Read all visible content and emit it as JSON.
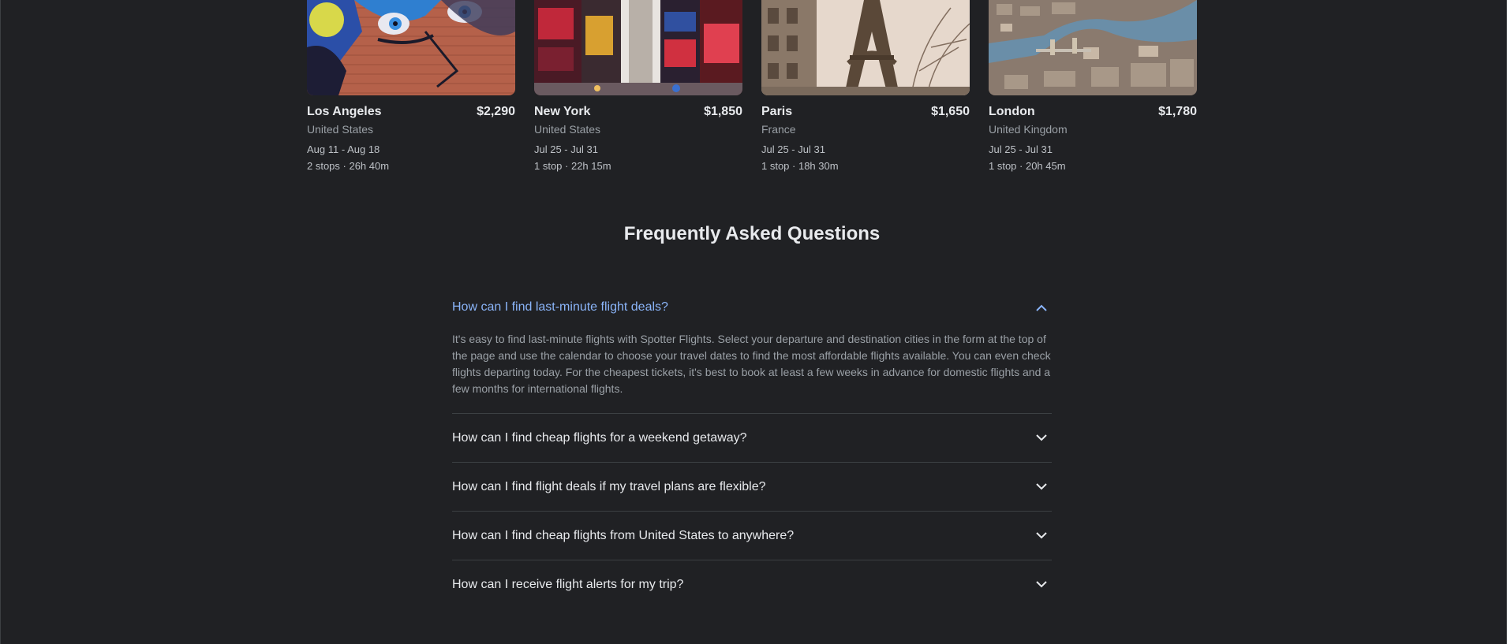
{
  "destinations": [
    {
      "city": "Los Angeles",
      "price": "$2,290",
      "country": "United States",
      "dates": "Aug 11 - Aug 18",
      "stops": "2 stops · 26h 40m",
      "image": "graffiti-mural"
    },
    {
      "city": "New York",
      "price": "$1,850",
      "country": "United States",
      "dates": "Jul 25 - Jul 31",
      "stops": "1 stop · 22h 15m",
      "image": "times-square"
    },
    {
      "city": "Paris",
      "price": "$1,650",
      "country": "France",
      "dates": "Jul 25 - Jul 31",
      "stops": "1 stop · 18h 30m",
      "image": "eiffel-tower"
    },
    {
      "city": "London",
      "price": "$1,780",
      "country": "United Kingdom",
      "dates": "Jul 25 - Jul 31",
      "stops": "1 stop · 20h 45m",
      "image": "tower-bridge-aerial"
    }
  ],
  "faq": {
    "title": "Frequently Asked Questions",
    "items": [
      {
        "question": "How can I find last-minute flight deals?",
        "answer": "It's easy to find last-minute flights with Spotter Flights. Select your departure and destination cities in the form at the top of the page and use the calendar to choose your travel dates to find the most affordable flights available. You can even check flights departing today. For the cheapest tickets, it's best to book at least a few weeks in advance for domestic flights and a few months for international flights.",
        "expanded": true
      },
      {
        "question": "How can I find cheap flights for a weekend getaway?",
        "expanded": false
      },
      {
        "question": "How can I find flight deals if my travel plans are flexible?",
        "expanded": false
      },
      {
        "question": "How can I find cheap flights from United States to anywhere?",
        "expanded": false
      },
      {
        "question": "How can I receive flight alerts for my trip?",
        "expanded": false
      }
    ]
  },
  "colors": {
    "background": "#202124",
    "accent": "#8ab4f8",
    "divider": "#3c4043"
  }
}
